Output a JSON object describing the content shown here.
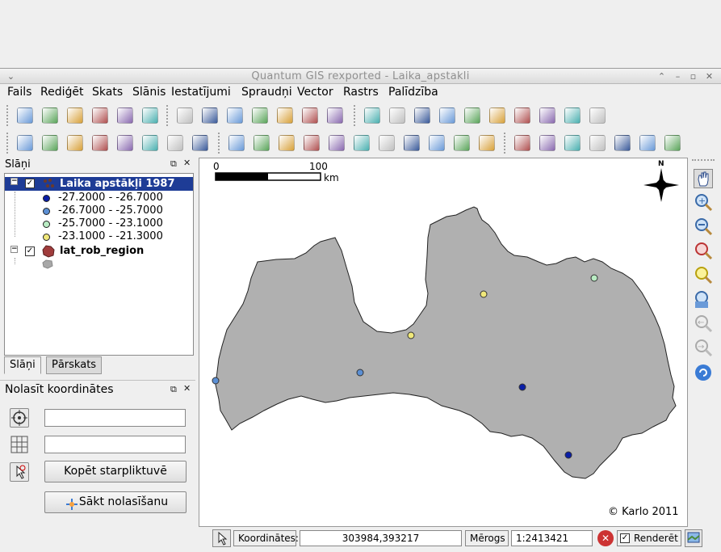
{
  "window": {
    "title": "Quantum GIS rexported - Laika_apstakli"
  },
  "menu": [
    {
      "label": "Fails"
    },
    {
      "label": "Rediģēt"
    },
    {
      "label": "Skats"
    },
    {
      "label": "Slānis"
    },
    {
      "label": "Iestatījumi"
    },
    {
      "label": "Spraudņi"
    },
    {
      "label": "Vector"
    },
    {
      "label": "Rastrs"
    },
    {
      "label": "Palīdzība"
    }
  ],
  "toolbar1_icons": [
    "new-project-icon",
    "open-project-icon",
    "save-project-icon",
    "save-as-icon",
    "print-composer-icon",
    "print-icon",
    "add-vector-layer-icon",
    "add-raster-layer-icon",
    "add-postgis-layer-icon",
    "add-spatialite-layer-icon",
    "add-wms-layer-icon",
    "new-vector-layer-icon",
    "remove-layer-icon",
    "identify-icon",
    "select-icon",
    "deselect-icon",
    "attribute-table-icon",
    "measure-line-icon",
    "map-tips-icon",
    "new-bookmark-icon",
    "show-bookmarks-icon",
    "label-icon",
    "text-annotation-icon"
  ],
  "toolbar2_icons": [
    "toggle-editing-icon",
    "save-edits-icon",
    "move-feature-icon",
    "node-tool-icon",
    "delete-selected-icon",
    "cut-features-icon",
    "copy-features-icon",
    "paste-features-icon",
    "undo-icon",
    "redo-icon",
    "simplify-feature-icon",
    "add-ring-icon",
    "add-part-icon",
    "delete-ring-icon",
    "delete-part-icon",
    "reshape-icon",
    "split-features-icon",
    "merge-features-icon",
    "rotate-point-icon",
    "copyright-label-icon",
    "georeferencer-icon",
    "globe-icon",
    "north-arrow-icon",
    "scale-bar-icon",
    "zoom-coordinate-icon",
    "plugin-icon"
  ],
  "layers_panel": {
    "title": "Slāņi",
    "layers": [
      {
        "name": "Laika apstākļi 1987",
        "checked": true,
        "classes": [
          {
            "label": "-27.2000 - -26.7000",
            "color": "#0a1ea6"
          },
          {
            "label": "-26.7000 - -25.7000",
            "color": "#5b8fd4"
          },
          {
            "label": "-25.7000 - -23.1000",
            "color": "#b9ecc3"
          },
          {
            "label": "-23.1000 - -21.3000",
            "color": "#f0e87a"
          }
        ]
      },
      {
        "name": "lat_rob_region",
        "checked": true
      }
    ],
    "tabs": [
      {
        "label": "Slāņi"
      },
      {
        "label": "Pārskats"
      }
    ]
  },
  "coord_panel": {
    "title": "Nolasīt koordinātes",
    "copy_button": "Kopēt starpliktuvē",
    "start_button": "Sākt nolasīšanu"
  },
  "map": {
    "scale_bar": {
      "start": "0",
      "end": "100",
      "unit": "km"
    },
    "north_label": "N",
    "copyright": "© Karlo 2011",
    "fill_color": "#b0b0b0"
  },
  "statusbar": {
    "coords_label": "Koordinātes:",
    "coords_value": "303984,393217",
    "scale_label": "Mērogs",
    "scale_value": "1:2413421",
    "render_label": "Renderēt",
    "render_checked": true
  }
}
